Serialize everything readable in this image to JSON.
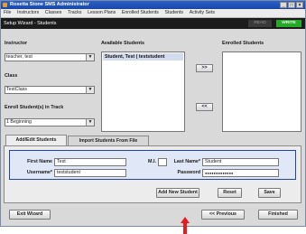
{
  "window": {
    "title": "Rosetta Stone SMS Administrator",
    "buttons": {
      "minimize": "_",
      "maximize": "□",
      "close": "×"
    }
  },
  "menu": [
    "File",
    "Instructors",
    "Classes",
    "Tracks",
    "Lesson Plans",
    "Enrolled Students",
    "Students",
    "Activity Sets"
  ],
  "wizard": {
    "title": "Setup Wizard - Students",
    "read_label": "READ",
    "write_label": "WRITE"
  },
  "left": {
    "instructor_label": "Instructor",
    "instructor_value": "teacher, test",
    "class_label": "Class",
    "class_value": "TestClass",
    "track_label": "Enroll Student(s) in Track",
    "track_value": "1 Beginning"
  },
  "available": {
    "label": "Available Students",
    "items": [
      "Student, Test ( teststudent"
    ]
  },
  "transfer": {
    "add": ">>",
    "remove": "<<"
  },
  "enrolled": {
    "label": "Enrolled Students"
  },
  "tabs": [
    "Add/Edit Students",
    "Import Students From File"
  ],
  "form": {
    "first_name_label": "First Name",
    "first_name_value": "Test",
    "mi_label": "M.I.",
    "mi_value": "",
    "last_name_label": "Last Name*",
    "last_name_value": "Student",
    "username_label": "Username*",
    "username_value": "teststudent",
    "password_label": "Password",
    "password_value": "●●●●●●●●●●●●●"
  },
  "actions": {
    "add_new": "Add New Student",
    "reset": "Reset",
    "save": "Save"
  },
  "footer": {
    "exit": "Exit Wizard",
    "previous": "<< Previous",
    "finished": "Finished"
  },
  "colors": {
    "titlebar": "#1946a6",
    "write_badge": "#28a828",
    "pointer_arrow": "#e81c1c"
  }
}
